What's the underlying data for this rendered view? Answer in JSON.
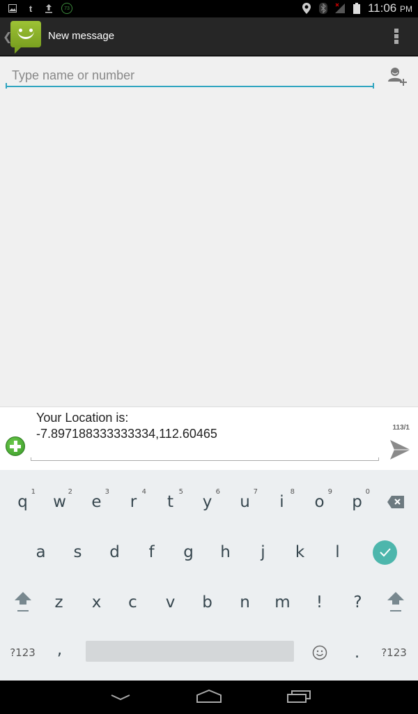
{
  "status_bar": {
    "left_icons": [
      "image-icon",
      "tumblr-icon",
      "upload-icon",
      "battery-saver-73-icon"
    ],
    "badge_value": "73",
    "right_icons": [
      "location-icon",
      "bluetooth-icon",
      "signal-no-service-icon",
      "battery-icon"
    ],
    "time": "11:06",
    "ampm": "PM"
  },
  "action_bar": {
    "title": "New message",
    "app_icon": "messaging-app-icon",
    "menu_icon": "overflow-menu-icon"
  },
  "recipient": {
    "placeholder": "Type name or number",
    "value": "",
    "add_contact_icon": "add-person-icon"
  },
  "compose": {
    "attach_icon": "add-attachment-icon",
    "message_text": "Your Location is:\n-7.897188333333334,112.60465",
    "char_counter": "113/1",
    "send_icon": "send-icon"
  },
  "keyboard": {
    "row1": [
      {
        "key": "q",
        "hint": "1"
      },
      {
        "key": "w",
        "hint": "2"
      },
      {
        "key": "e",
        "hint": "3"
      },
      {
        "key": "r",
        "hint": "4"
      },
      {
        "key": "t",
        "hint": "5"
      },
      {
        "key": "y",
        "hint": "6"
      },
      {
        "key": "u",
        "hint": "7"
      },
      {
        "key": "i",
        "hint": "8"
      },
      {
        "key": "o",
        "hint": "9"
      },
      {
        "key": "p",
        "hint": "0"
      }
    ],
    "row2": [
      "a",
      "s",
      "d",
      "f",
      "g",
      "h",
      "j",
      "k",
      "l"
    ],
    "row3": [
      "z",
      "x",
      "c",
      "v",
      "b",
      "n",
      "m",
      "!",
      "?"
    ],
    "symbols_label": "?123",
    "comma": ",",
    "period": ".",
    "accent_color": "#4db6ac"
  },
  "nav_bar": {
    "buttons": [
      "back-icon",
      "home-icon",
      "recent-apps-icon"
    ]
  }
}
